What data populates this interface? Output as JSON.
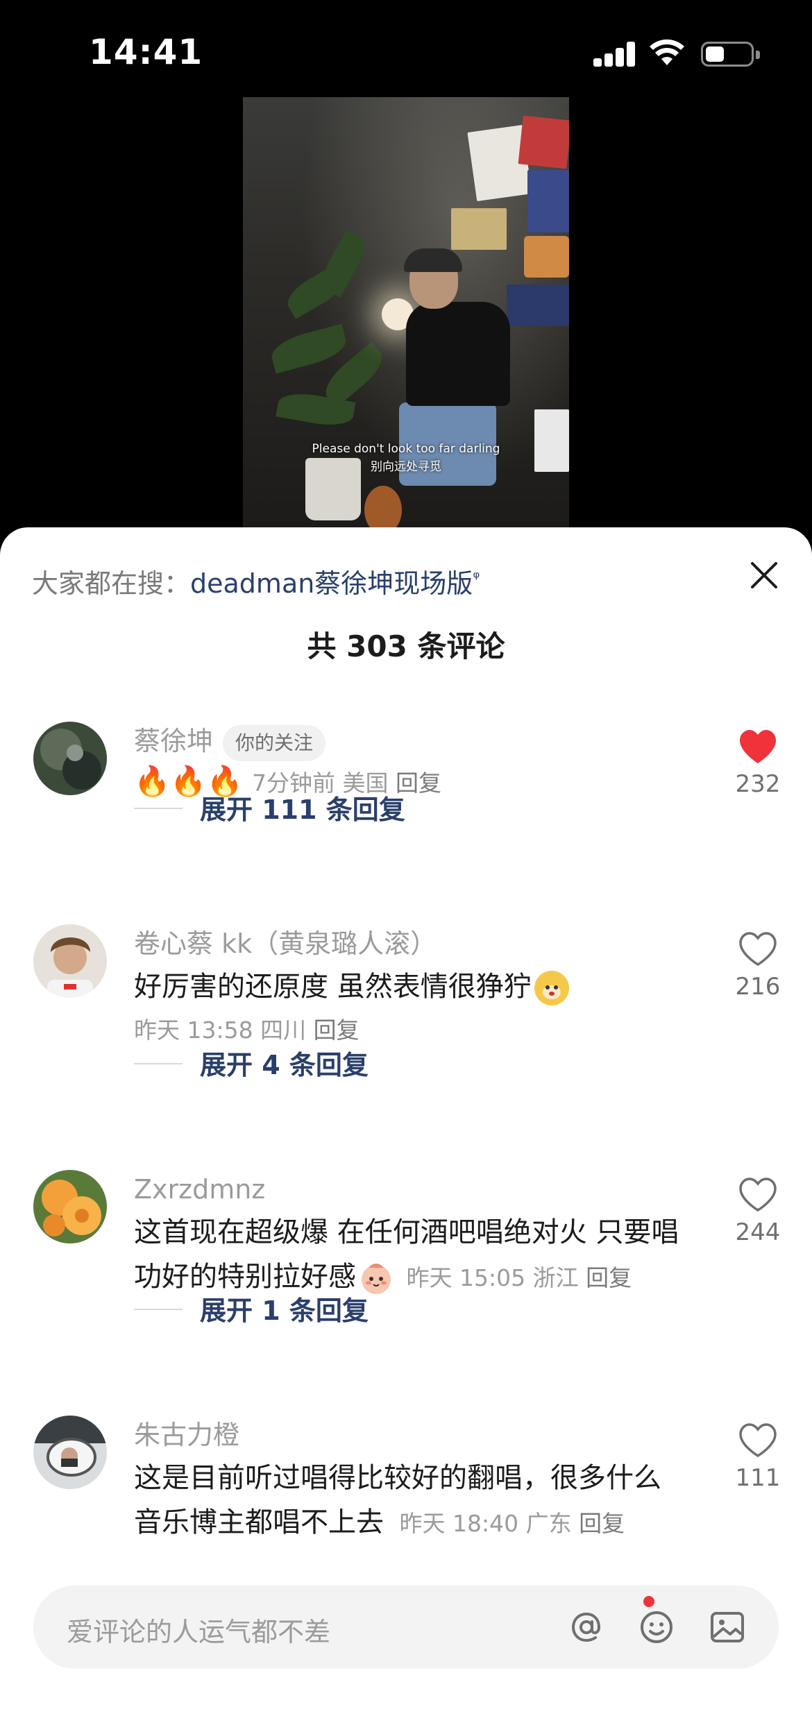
{
  "status_bar": {
    "time": "14:41"
  },
  "video": {
    "subtitle_en": "Please don't look too far darling",
    "subtitle_cn": "别向远处寻觅"
  },
  "search": {
    "prefix": "大家都在搜：",
    "query": "deadman蔡徐坤现场版"
  },
  "comments_header": {
    "title": "共 303 条评论"
  },
  "comments": [
    {
      "username": "蔡徐坤",
      "tag": "你的关注",
      "text": "🔥🔥🔥",
      "time": "7分钟前",
      "location": "美国",
      "reply_label": "回复",
      "likes": "232",
      "liked": true,
      "expand_label": "展开 111 条回复"
    },
    {
      "username": "卷心蔡 kk（黄泉璐人滚）",
      "text": "好厉害的还原度 虽然表情很狰狞",
      "time": "昨天 13:58",
      "location": "四川",
      "reply_label": "回复",
      "likes": "216",
      "liked": false,
      "expand_label": "展开 4 条回复"
    },
    {
      "username": "Zxrzdmnz",
      "text_line1": "这首现在超级爆 在任何酒吧唱绝对火 只要唱",
      "text_line2": "功好的特别拉好感",
      "time": "昨天 15:05",
      "location": "浙江",
      "reply_label": "回复",
      "likes": "244",
      "liked": false,
      "expand_label": "展开 1 条回复"
    },
    {
      "username": "朱古力橙",
      "text_line1": "这是目前听过唱得比较好的翻唱，很多什么",
      "text_line2": "音乐博主都唱不上去",
      "time": "昨天 18:40",
      "location": "广东",
      "reply_label": "回复",
      "likes": "111",
      "liked": false
    }
  ],
  "input": {
    "placeholder": "爱评论的人运气都不差"
  },
  "colors": {
    "like_red": "#f0323a",
    "link_blue": "#2a3f6b"
  }
}
